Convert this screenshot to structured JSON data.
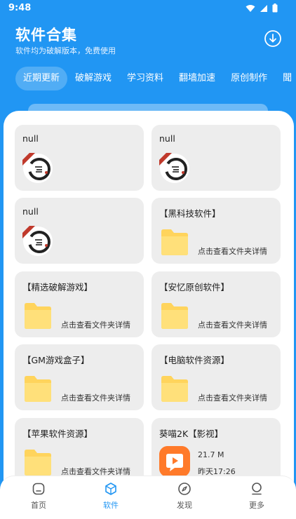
{
  "status_bar": {
    "time": "9:48"
  },
  "header": {
    "title": "软件合集",
    "subtitle": "软件均为破解版本，免费使用"
  },
  "tabs": [
    {
      "label": "近期更新",
      "active": true
    },
    {
      "label": "破解游戏"
    },
    {
      "label": "学习资料"
    },
    {
      "label": "翻墙加速"
    },
    {
      "label": "原创制作"
    },
    {
      "label": "聞"
    }
  ],
  "cards": [
    {
      "title": "null",
      "type": "avatar"
    },
    {
      "title": "null",
      "type": "avatar"
    },
    {
      "title": "null",
      "type": "avatar"
    },
    {
      "title": "【黑科技软件】",
      "type": "folder",
      "desc": "点击查看文件夹详情"
    },
    {
      "title": "【精选破解游戏】",
      "type": "folder",
      "desc": "点击查看文件夹详情"
    },
    {
      "title": "【安忆原创软件】",
      "type": "folder",
      "desc": "点击查看文件夹详情"
    },
    {
      "title": "【GM游戏盒子】",
      "type": "folder",
      "desc": "点击查看文件夹详情"
    },
    {
      "title": "【电脑软件资源】",
      "type": "folder",
      "desc": "点击查看文件夹详情"
    },
    {
      "title": "【苹果软件资源】",
      "type": "folder",
      "desc": "点击查看文件夹详情"
    },
    {
      "title": "葵喵2K【影视】",
      "type": "file",
      "size": "21.7 M",
      "time": "昨天17:26"
    }
  ],
  "bottom_nav": [
    {
      "label": "首页",
      "icon": "home-icon"
    },
    {
      "label": "软件",
      "icon": "cube-icon",
      "active": true
    },
    {
      "label": "发现",
      "icon": "compass-icon"
    },
    {
      "label": "更多",
      "icon": "profile-icon"
    }
  ],
  "colors": {
    "primary": "#2196F3",
    "card": "#ededed",
    "folder": "#FFD45C",
    "app": "#FF7A2A"
  }
}
